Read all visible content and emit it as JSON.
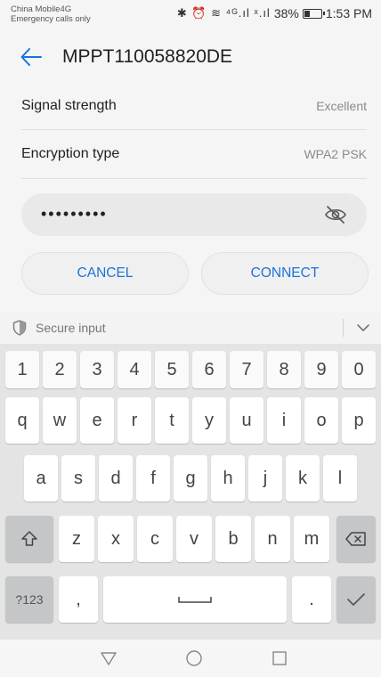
{
  "status_bar": {
    "carrier_line1": "China Mobile4G",
    "carrier_line2": "Emergency calls only",
    "icons": "✱ ⏰ ≋ ⁴ᴳ.ıl ˣ.ıl",
    "battery_percent": "38%",
    "battery_level": 0.38,
    "time": "1:53 PM"
  },
  "header": {
    "back_icon": "back-arrow-icon",
    "title": "MPPT110058820DE"
  },
  "details": [
    {
      "label": "Signal strength",
      "value": "Excellent"
    },
    {
      "label": "Encryption type",
      "value": "WPA2 PSK"
    }
  ],
  "password": {
    "masked_value": "•••••••••",
    "visibility_icon": "eye-off-icon"
  },
  "actions": {
    "cancel_label": "CANCEL",
    "connect_label": "CONNECT"
  },
  "colors": {
    "accent": "#1a73d9",
    "keyboard_bg": "#e4e4e4",
    "function_key": "#c4c6c8"
  },
  "keyboard": {
    "secure_label": "Secure input",
    "secure_icon": "shield-icon",
    "collapse_icon": "chevron-down-icon",
    "row_numbers": [
      "1",
      "2",
      "3",
      "4",
      "5",
      "6",
      "7",
      "8",
      "9",
      "0"
    ],
    "row1": [
      "q",
      "w",
      "e",
      "r",
      "t",
      "y",
      "u",
      "i",
      "o",
      "p"
    ],
    "row2": [
      "a",
      "s",
      "d",
      "f",
      "g",
      "h",
      "j",
      "k",
      "l"
    ],
    "row3": [
      "z",
      "x",
      "c",
      "v",
      "b",
      "n",
      "m"
    ],
    "shift_icon": "shift-icon",
    "backspace_icon": "backspace-icon",
    "symbols_label": "?123",
    "comma_label": ",",
    "space_icon": "space-bar-icon",
    "period_label": ".",
    "enter_icon": "checkmark-icon"
  },
  "nav_bar": {
    "back_icon": "triangle-back-icon",
    "home_icon": "circle-home-icon",
    "recents_icon": "square-recents-icon"
  }
}
